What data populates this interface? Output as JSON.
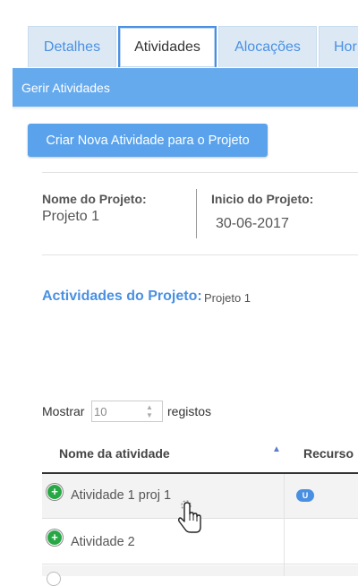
{
  "tabs": [
    {
      "label": "Detalhes"
    },
    {
      "label": "Atividades"
    },
    {
      "label": "Alocações"
    },
    {
      "label": "Hor"
    }
  ],
  "section_bar": {
    "title": "Gerir Atividades"
  },
  "create_button": {
    "label": "Criar Nova Atividade para o Projeto"
  },
  "project": {
    "name_label": "Nome do Projeto:",
    "name_value": "Projeto 1",
    "start_label": "Inicio do Projeto:",
    "start_value": "30-06-2017"
  },
  "activities_section": {
    "title": "Actividades do Projeto:",
    "project_name": "Projeto 1"
  },
  "table_controls": {
    "show_label": "Mostrar",
    "page_size": "10",
    "records_label": "registos"
  },
  "table": {
    "columns": [
      {
        "label": "Nome da atividade"
      },
      {
        "label": "Recurso"
      }
    ],
    "rows": [
      {
        "name": "Atividade 1 proj 1",
        "resource_badge": "U"
      },
      {
        "name": "Atividade 2",
        "resource_badge": ""
      }
    ]
  },
  "colors": {
    "accent": "#4a90e2",
    "tab_bg": "#dce9f5",
    "bar_bg": "#66aaee",
    "button_bg": "#5aa3ec",
    "expand_icon": "#28a745"
  },
  "icons": {
    "expand": "plus-circle-icon",
    "sort": "sort-ascending-icon",
    "cursor": "hand-pointer-icon"
  }
}
